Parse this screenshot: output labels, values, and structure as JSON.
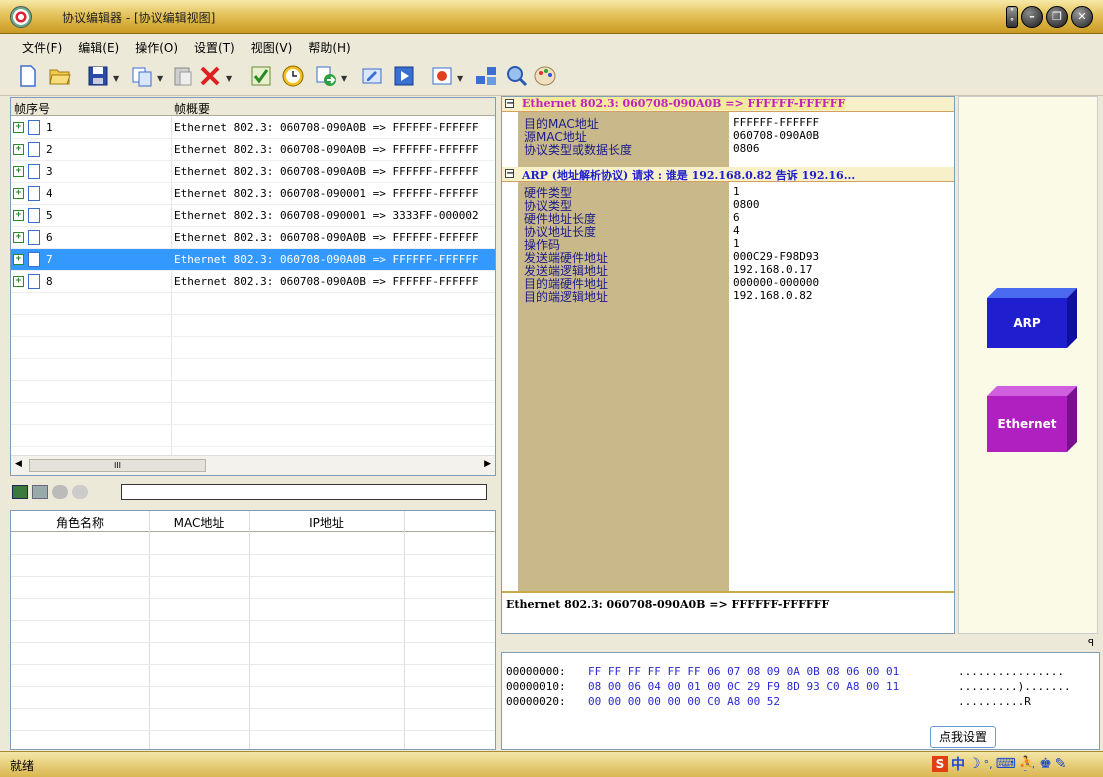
{
  "window": {
    "title": "协议编辑器 - [协议编辑视图]"
  },
  "menu": [
    "文件(F)",
    "编辑(E)",
    "操作(O)",
    "设置(T)",
    "视图(V)",
    "帮助(H)"
  ],
  "toolbar_icons": [
    "new-icon",
    "open-icon",
    "save-icon",
    "copy-icon",
    "paste-icon",
    "delete-icon",
    "check-icon",
    "clock-icon",
    "send-icon",
    "edit-icon",
    "play-icon",
    "info-icon",
    "network-icon",
    "search-icon",
    "palette-icon"
  ],
  "frame_list": {
    "col_index": "帧序号",
    "col_summary": "帧概要",
    "rows": [
      {
        "num": "1",
        "summary": "Ethernet 802.3: 060708-090A0B => FFFFFF-FFFFFF"
      },
      {
        "num": "2",
        "summary": "Ethernet 802.3: 060708-090A0B => FFFFFF-FFFFFF"
      },
      {
        "num": "3",
        "summary": "Ethernet 802.3: 060708-090A0B => FFFFFF-FFFFFF"
      },
      {
        "num": "4",
        "summary": "Ethernet 802.3: 060708-090001 => FFFFFF-FFFFFF"
      },
      {
        "num": "5",
        "summary": "Ethernet 802.3: 060708-090001 => 3333FF-000002"
      },
      {
        "num": "6",
        "summary": "Ethernet 802.3: 060708-090A0B => FFFFFF-FFFFFF"
      },
      {
        "num": "7",
        "summary": "Ethernet 802.3: 060708-090A0B => FFFFFF-FFFFFF"
      },
      {
        "num": "8",
        "summary": "Ethernet 802.3: 060708-090A0B => FFFFFF-FFFFFF"
      }
    ],
    "selected_row": "7",
    "scroll_glyph": "III"
  },
  "role_table": {
    "col_role": "角色名称",
    "col_mac": "MAC地址",
    "col_ip": "IP地址"
  },
  "detail": {
    "eth_header": "Ethernet 802.3: 060708-090A0B => FFFFFF-FFFFFF",
    "eth_fields": [
      {
        "label": "目的MAC地址",
        "value": "FFFFFF-FFFFFF"
      },
      {
        "label": "源MAC地址",
        "value": "060708-090A0B"
      },
      {
        "label": "协议类型或数据长度",
        "value": "0806"
      }
    ],
    "arp_header": "ARP (地址解析协议) 请求 : 谁是 192.168.0.82 告诉 192.16...",
    "arp_fields": [
      {
        "label": "硬件类型",
        "value": "1"
      },
      {
        "label": "协议类型",
        "value": "0800"
      },
      {
        "label": "硬件地址长度",
        "value": "6"
      },
      {
        "label": "协议地址长度",
        "value": "4"
      },
      {
        "label": "操作码",
        "value": "1"
      },
      {
        "label": "发送端硬件地址",
        "value": "000C29-F98D93"
      },
      {
        "label": "发送端逻辑地址",
        "value": "192.168.0.17"
      },
      {
        "label": "目的端硬件地址",
        "value": "000000-000000"
      },
      {
        "label": "目的端逻辑地址",
        "value": "192.168.0.82"
      }
    ],
    "footer": "Ethernet 802.3: 060708-090A0B => FFFFFF-FFFFFF"
  },
  "layers": [
    {
      "label": "ARP",
      "color": "#1f1fd0"
    },
    {
      "label": "Ethernet",
      "color": "#b020c0"
    }
  ],
  "hex": {
    "pin": "ꟼ",
    "lines": [
      {
        "offset": "00000000:",
        "bytes": "FF FF FF FF FF FF 06 07 08 09 0A 0B 08 06 00 01",
        "ascii": "................"
      },
      {
        "offset": "00000010:",
        "bytes": "08 00 06 04 00 01 00 0C 29 F9 8D 93 C0 A8 00 11",
        "ascii": ".........)......."
      },
      {
        "offset": "00000020:",
        "bytes": "00 00 00 00 00 00 C0 A8 00 52",
        "ascii": "..........R"
      }
    ]
  },
  "status": {
    "text": "就绪",
    "tooltip": "点我设置",
    "ime": "中"
  }
}
